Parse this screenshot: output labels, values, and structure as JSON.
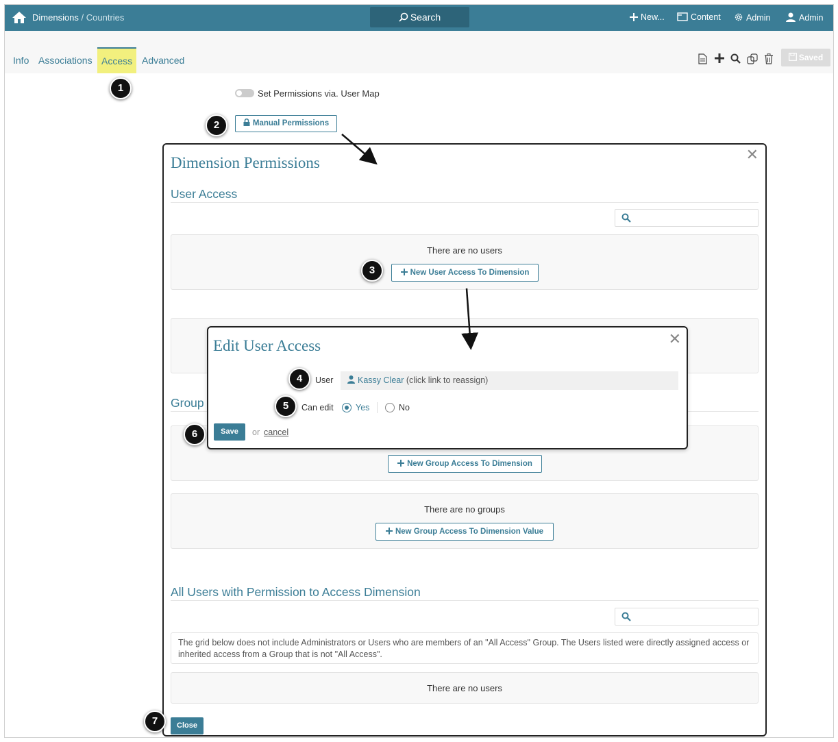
{
  "topbar": {
    "breadcrumb_parent": "Dimensions",
    "breadcrumb_sep": " / ",
    "breadcrumb_current": "Countries",
    "search_label": "Search",
    "new_label": "New...",
    "content_label": "Content",
    "admin_label": "Admin",
    "user_label": "Admin"
  },
  "tabs": [
    {
      "label": "Info"
    },
    {
      "label": "Associations"
    },
    {
      "label": "Access"
    },
    {
      "label": "Advanced"
    }
  ],
  "toolbar": {
    "saved_label": "Saved"
  },
  "access": {
    "toggle_label": "Set Permissions via. User Map",
    "manual_permissions_label": "Manual Permissions"
  },
  "permissions": {
    "title": "Dimension Permissions",
    "user_access_title": "User Access",
    "no_users_text": "There are no users",
    "new_user_access_label": "New User Access To Dimension",
    "group_title": "Group",
    "new_group_access_label": "New Group Access To Dimension",
    "no_groups_text": "There are no groups",
    "new_group_value_label": "New Group Access To Dimension Value",
    "all_users_title": "All Users with Permission to Access Dimension",
    "note_text": "The grid below does not include Administrators or Users who are members of an \"All Access\" Group. The Users listed were directly assigned access or inherited access from a Group that is not \"All Access\".",
    "no_users_text_2": "There are no users",
    "close_label": "Close"
  },
  "edit_user": {
    "title": "Edit User Access",
    "user_label": "User",
    "user_name": "Kassy Clear",
    "user_hint": " (click link to reassign)",
    "can_edit_label": "Can edit",
    "yes_label": "Yes",
    "no_label": "No",
    "save_label": "Save",
    "or_text": "or",
    "cancel_label": "cancel"
  },
  "badges": [
    "1",
    "2",
    "3",
    "4",
    "5",
    "6",
    "7"
  ],
  "colors": {
    "accent": "#3b7d96",
    "topbar": "#3b7d96",
    "highlight": "#f2f07e"
  }
}
